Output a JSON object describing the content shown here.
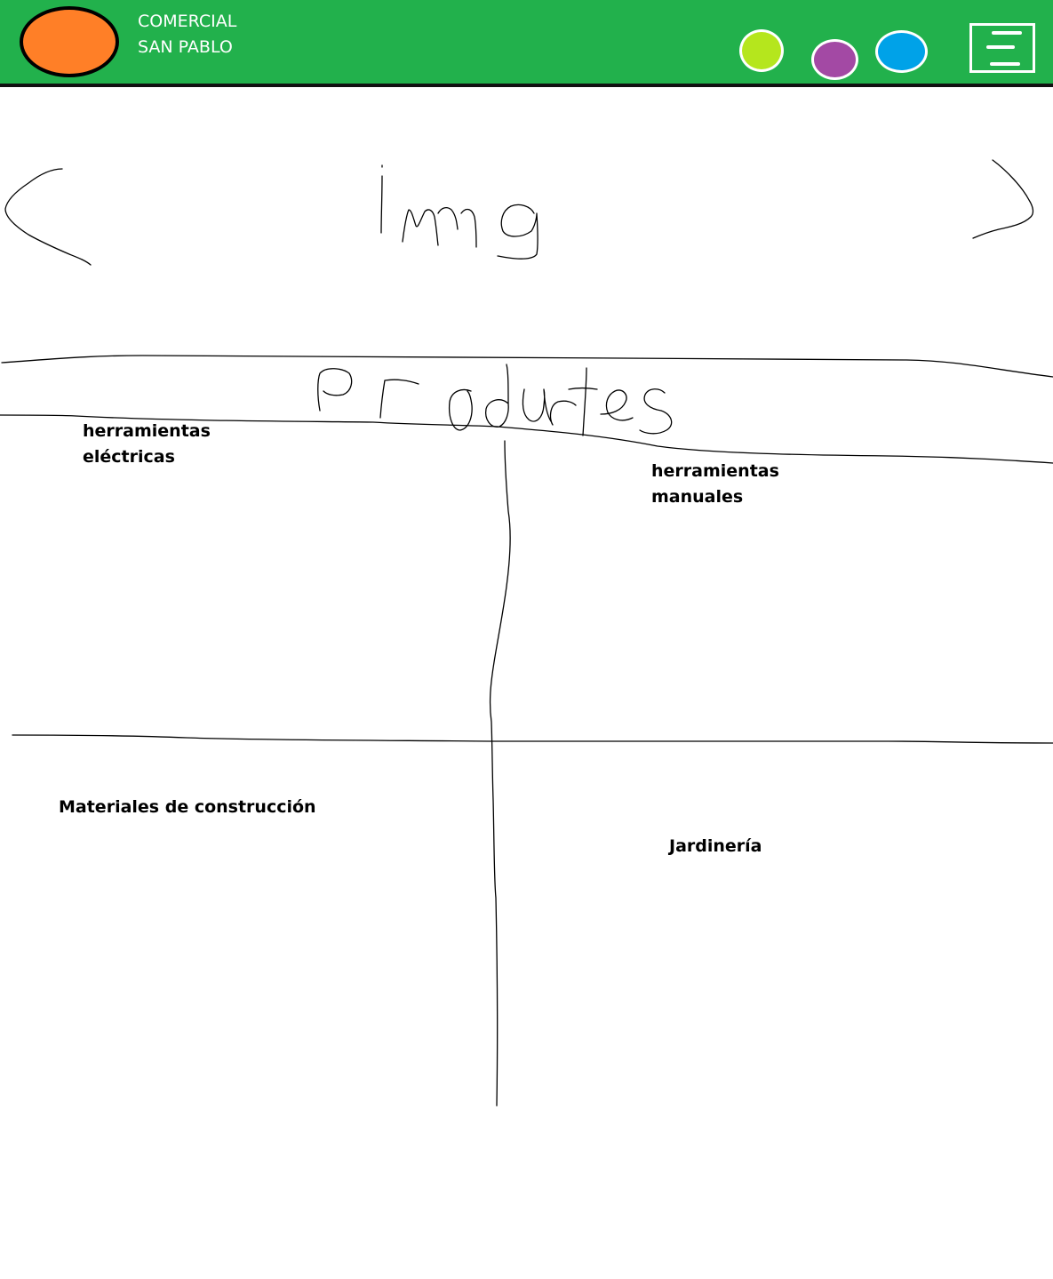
{
  "header": {
    "background_color": "#22b14c",
    "logo_color": "#ff7f27",
    "brand_line1": "COMERCIAL",
    "brand_line2": "SAN PABLO",
    "color_dots": [
      {
        "name": "green",
        "color": "#b5e61d"
      },
      {
        "name": "purple",
        "color": "#a349a4"
      },
      {
        "name": "blue",
        "color": "#00a2e8"
      }
    ],
    "menu_icon": "hamburger-menu-icon"
  },
  "carousel": {
    "image_placeholder": "img",
    "prev_icon": "chevron-left-icon",
    "next_icon": "chevron-right-icon"
  },
  "section": {
    "title": "productos"
  },
  "categories": [
    {
      "line1": "herramientas",
      "line2": "eléctricas"
    },
    {
      "line1": "herramientas",
      "line2": "manuales"
    },
    {
      "line1": "Materiales de construcción",
      "line2": ""
    },
    {
      "line1": "Jardinería",
      "line2": ""
    }
  ]
}
